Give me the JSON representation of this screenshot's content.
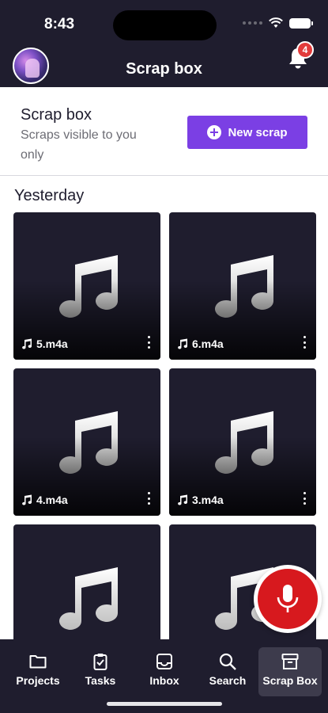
{
  "status_bar": {
    "time": "8:43"
  },
  "header": {
    "title": "Scrap box",
    "notification_count": "4"
  },
  "section": {
    "title": "Scrap box",
    "subtitle": "Scraps visible to you only",
    "new_button_label": "New scrap"
  },
  "group": {
    "label": "Yesterday"
  },
  "scraps": [
    {
      "name": "5.m4a",
      "icon": "music-note-icon"
    },
    {
      "name": "6.m4a",
      "icon": "music-note-icon"
    },
    {
      "name": "4.m4a",
      "icon": "music-note-icon"
    },
    {
      "name": "3.m4a",
      "icon": "music-note-icon"
    },
    {
      "name": "",
      "icon": "music-note-icon"
    },
    {
      "name": "",
      "icon": "music-note-icon"
    }
  ],
  "record_button": {
    "icon": "microphone-icon",
    "color": "#d7191e"
  },
  "tabbar": {
    "tabs": [
      {
        "label": "Projects",
        "icon": "folder-icon"
      },
      {
        "label": "Tasks",
        "icon": "clipboard-check-icon"
      },
      {
        "label": "Inbox",
        "icon": "inbox-icon"
      },
      {
        "label": "Search",
        "icon": "search-icon"
      },
      {
        "label": "Scrap Box",
        "icon": "archive-box-icon"
      }
    ],
    "active": "Scrap Box"
  },
  "colors": {
    "header_bg": "#1f1d2e",
    "accent": "#7b3fe4",
    "badge": "#e23b3b"
  }
}
